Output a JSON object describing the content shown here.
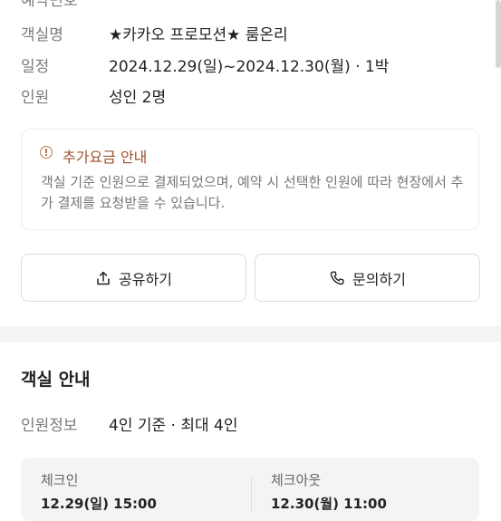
{
  "reservation": {
    "booking_no_label": "예약번호",
    "room_label": "객실명",
    "room_value": "★카카오 프로모션★ 룸온리",
    "schedule_label": "일정",
    "schedule_value": "2024.12.29(일)~2024.12.30(월) · 1박",
    "guests_label": "인원",
    "guests_value": "성인 2명"
  },
  "notice": {
    "title": "추가요금 안내",
    "body": "객실 기준 인원으로 결제되었으며, 예약 시 선택한 인원에 따라 현장에서 추가 결제를 요청받을 수 있습니다."
  },
  "actions": {
    "share_label": "공유하기",
    "inquiry_label": "문의하기"
  },
  "room_info": {
    "title": "객실 안내",
    "capacity_label": "인원정보",
    "capacity_value": "4인 기준 · 최대 4인",
    "checkin_label": "체크인",
    "checkin_value": "12.29(일) 15:00",
    "checkout_label": "체크아웃",
    "checkout_value": "12.30(월) 11:00"
  },
  "icons": {
    "notice": "info-icon",
    "share": "share-icon",
    "inquiry": "phone-icon"
  },
  "colors": {
    "notice_accent": "#a0522d",
    "label": "#7a7a7a",
    "text": "#222222",
    "divider": "#f4f4f5"
  }
}
